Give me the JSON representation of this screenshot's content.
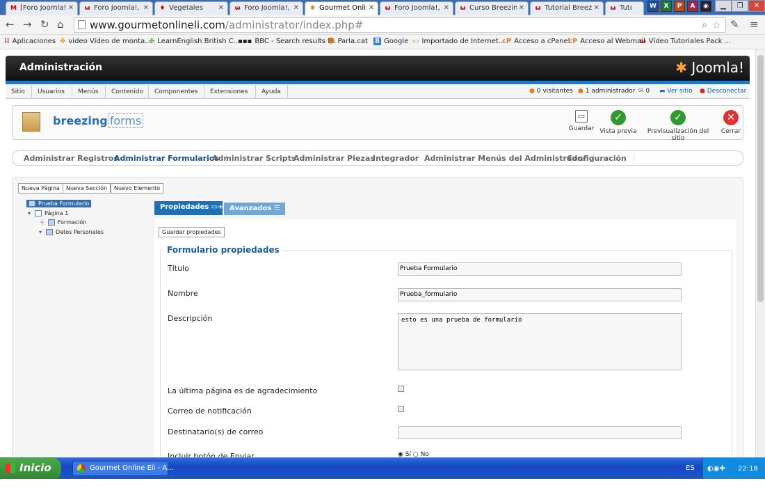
{
  "browser": {
    "tabs": [
      {
        "label": "[Foro Joomla!",
        "icon": "gmail-icon"
      },
      {
        "label": "Foro Joomla!, ",
        "icon": "joomla-forum-icon"
      },
      {
        "label": "Vegetales",
        "icon": "site-icon"
      },
      {
        "label": "Foro Joomla!, ",
        "icon": "joomla-forum-icon"
      },
      {
        "label": "Gourmet Onlin",
        "icon": "joomla-icon"
      },
      {
        "label": "Foro Joomla!, ",
        "icon": "joomla-forum-icon"
      },
      {
        "label": "Curso Breezin",
        "icon": "joomla-forum-icon"
      },
      {
        "label": "Tutorial Breezi",
        "icon": "joomla-forum-icon"
      },
      {
        "label": "Tutori",
        "icon": "joomla-forum-icon"
      }
    ],
    "url_host": "www.gourmetonlineli.com",
    "url_path": "/administrator/index.php#",
    "bookmarks": [
      "Aplicaciones",
      "video Vídeo de monta...",
      "LearnEnglish  British C...",
      "BBC - Search results f...",
      "Parla.cat",
      "Google",
      "Importado de Internet...",
      "Acceso a cPanel",
      "Acceso al Webmail",
      "Vídeo Tutoriales Pack ..."
    ]
  },
  "admin": {
    "title": "Administración",
    "logo": "Joomla!",
    "menu": [
      "Sitio",
      "Usuarios",
      "Menús",
      "Contenido",
      "Componentes",
      "Extensiones",
      "Ayuda"
    ],
    "status": {
      "visitors": "0 visitantes",
      "admins": "1 administrador",
      "messages": "0",
      "view_site": "Ver sitio",
      "logout": "Desconectar"
    }
  },
  "toolbar": {
    "component_name_a": "breezing",
    "component_name_b": "forms",
    "buttons": [
      {
        "label": "Guardar",
        "icon": "save-icon"
      },
      {
        "label": "Vista previa",
        "icon": "check-icon"
      },
      {
        "label": "Previsualización del sitio",
        "icon": "check-icon"
      },
      {
        "label": "Cerrar",
        "icon": "close-icon"
      }
    ]
  },
  "subnav": [
    {
      "label": "Administrar Registros",
      "active": false
    },
    {
      "label": "Administrar Formularios",
      "active": true
    },
    {
      "label": "Administrar Scripts",
      "active": false
    },
    {
      "label": "Administrar Piezas",
      "active": false
    },
    {
      "label": "Integrador",
      "active": false
    },
    {
      "label": "Administrar Menús del Administrador",
      "active": false
    },
    {
      "label": "Configuración",
      "active": false
    }
  ],
  "editor": {
    "buttons": [
      "Nueva Página",
      "Nueva Sección",
      "Nuevo Elemento"
    ],
    "tree": {
      "root": "Prueba Formulario",
      "page": "Página 1",
      "sections": [
        "Formación",
        "Datos Personales"
      ]
    },
    "tabs": [
      "Propiedades",
      "Avanzados"
    ],
    "save_props": "Guardar propiedades",
    "fieldset_legend": "Formulario propiedades",
    "fields": {
      "titulo_label": "Título",
      "titulo_value": "Prueba Formulario",
      "nombre_label": "Nombre",
      "nombre_value": "Prueba_formulario",
      "descripcion_label": "Descripción",
      "descripcion_value": "esto es una prueba de formulario",
      "ultima_label": "La última página es de agradecimiento",
      "correo_label": "Correo de notificación",
      "destinatarios_label": "Destinatario(s) de correo",
      "destinatarios_value": "",
      "enviar_label": "Incluir botón de Enviar",
      "si_label": "Sí",
      "no_label": "No"
    }
  },
  "taskbar": {
    "start": "Inicio",
    "window": "Gourmet Online Eli - A...",
    "lang": "ES",
    "clock": "22:18"
  },
  "colors": {
    "accent_blue": "#1f7ac5",
    "active_nav": "#1b4f8c",
    "green_ok": "#2f9a2f",
    "red_close": "#d33"
  }
}
